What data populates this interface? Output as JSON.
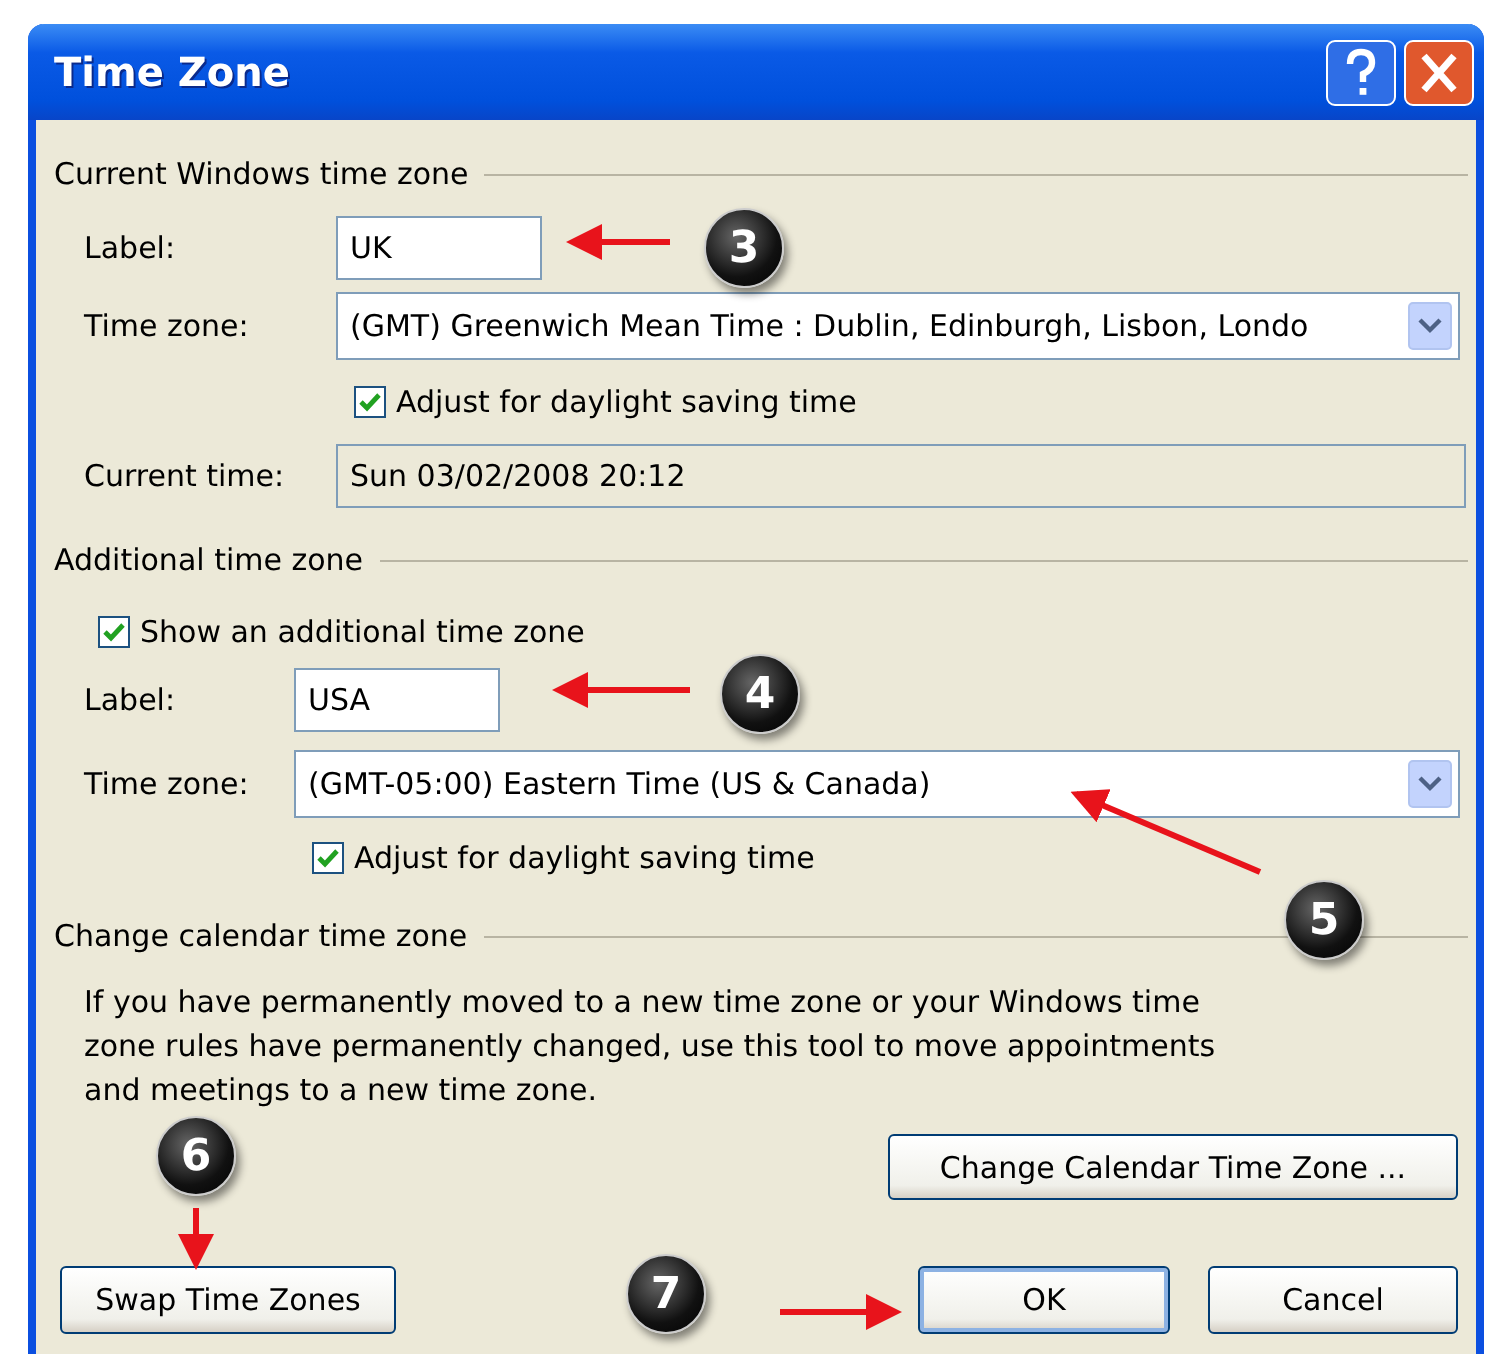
{
  "window": {
    "title": "Time Zone"
  },
  "current_section": {
    "heading": "Current Windows time zone",
    "label_field": {
      "label": "Label:",
      "value": "UK"
    },
    "time_zone": {
      "label": "Time zone:",
      "value": "(GMT) Greenwich Mean Time : Dublin, Edinburgh, Lisbon, Londo"
    },
    "daylight": {
      "label": "Adjust for daylight saving time",
      "checked": true
    },
    "current_time": {
      "label": "Current time:",
      "value": "Sun 03/02/2008 20:12"
    }
  },
  "additional_section": {
    "heading": "Additional time zone",
    "show": {
      "label": "Show an additional time zone",
      "checked": true
    },
    "label_field": {
      "label": "Label:",
      "value": "USA"
    },
    "time_zone": {
      "label": "Time zone:",
      "value": "(GMT-05:00) Eastern Time (US & Canada)"
    },
    "daylight": {
      "label": "Adjust for daylight saving time",
      "checked": true
    }
  },
  "calendar_section": {
    "heading": "Change calendar time zone",
    "description": "If you have permanently moved to a new time zone or your Windows time zone rules have permanently changed, use this tool to move appointments and meetings to a new time zone.",
    "button": "Change Calendar Time Zone ..."
  },
  "buttons": {
    "swap": "Swap Time Zones",
    "ok": "OK",
    "cancel": "Cancel"
  },
  "callouts": [
    {
      "number": "3"
    },
    {
      "number": "4"
    },
    {
      "number": "5"
    },
    {
      "number": "6"
    },
    {
      "number": "7"
    }
  ]
}
